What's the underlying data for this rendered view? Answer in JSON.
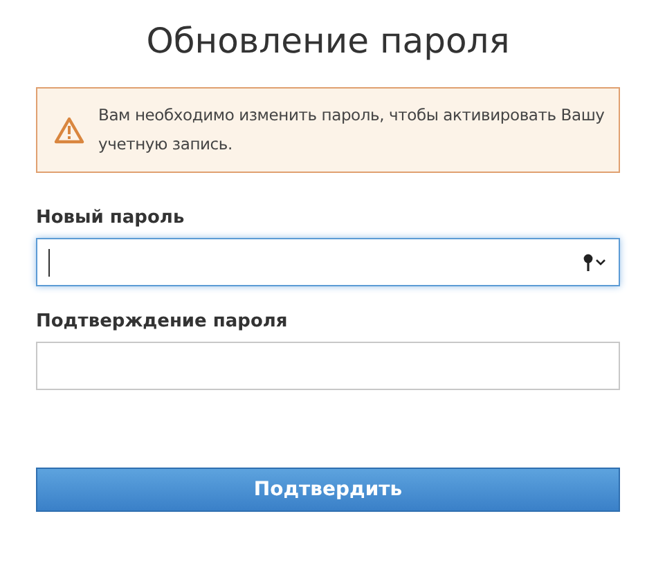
{
  "title": "Обновление пароля",
  "alert": {
    "text": "Вам необходимо изменить пароль, чтобы активировать Вашу учетную запись."
  },
  "fields": [
    {
      "label": "Новый пароль",
      "focused": true,
      "key_menu": true
    },
    {
      "label": "Подтверждение пароля",
      "focused": false,
      "key_menu": false
    }
  ],
  "submit_button": "Подтвердить"
}
